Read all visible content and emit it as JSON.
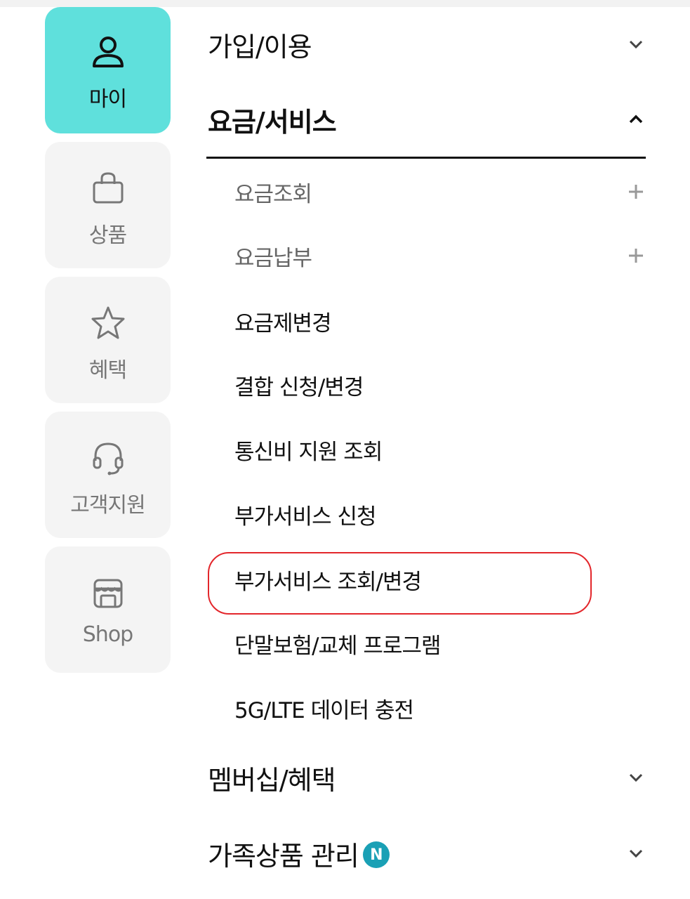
{
  "sidebar": {
    "items": [
      {
        "label": "마이",
        "icon": "person-icon",
        "active": true
      },
      {
        "label": "상품",
        "icon": "shopping-bag-icon"
      },
      {
        "label": "혜택",
        "icon": "star-icon"
      },
      {
        "label": "고객지원",
        "icon": "headset-icon"
      },
      {
        "label": "Shop",
        "icon": "store-icon"
      }
    ]
  },
  "menu": {
    "join_use": "가입/이용",
    "billing_service": "요금/서비스",
    "billing_subitems": [
      "요금조회",
      "요금납부",
      "요금제변경",
      "결합 신청/변경",
      "통신비 지원 조회",
      "부가서비스 신청",
      "부가서비스 조회/변경",
      "단말보험/교체 프로그램",
      "5G/LTE 데이터 충전"
    ],
    "membership": "멤버십/혜택",
    "family": "가족상품 관리",
    "family_badge": "N"
  },
  "colors": {
    "active_tab": "#5fe0dc",
    "highlight": "#e3262b",
    "badge": "#1aa0b5"
  }
}
